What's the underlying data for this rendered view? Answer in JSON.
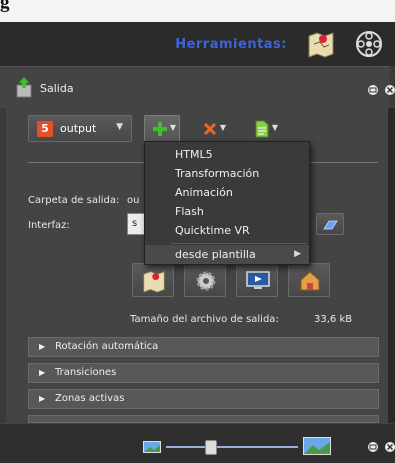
{
  "top_strip": {
    "text": "g"
  },
  "header": {
    "tools_label": "Herramientas:"
  },
  "panel": {
    "title": "Salida"
  },
  "toolbar": {
    "output_label": "output"
  },
  "dropdown": {
    "items": [
      "HTML5",
      "Transformación",
      "Animación",
      "Flash",
      "Quicktime VR"
    ],
    "template_item": "desde plantilla"
  },
  "fields": {
    "output_folder_label": "Carpeta de salida:",
    "output_folder_value": "ou",
    "interface_label": "Interfaz:",
    "interface_value": "s"
  },
  "output_size": {
    "label": "Tamaño del archivo de salida:",
    "value": "33,6 kB"
  },
  "sections": [
    "Rotación automática",
    "Transiciones",
    "Zonas activas"
  ],
  "icons": {
    "header": [
      "map-marker-icon",
      "film-reel-icon"
    ],
    "toolbar": [
      "html5-icon",
      "add-icon",
      "remove-icon",
      "document-icon"
    ],
    "actions": [
      "map-icon",
      "gear-icon",
      "monitor-icon",
      "house-icon"
    ]
  },
  "colors": {
    "tools_label": "#3d63d6",
    "html5": "#e34f26",
    "add": "#3fbf2f",
    "remove": "#f06a1d"
  }
}
